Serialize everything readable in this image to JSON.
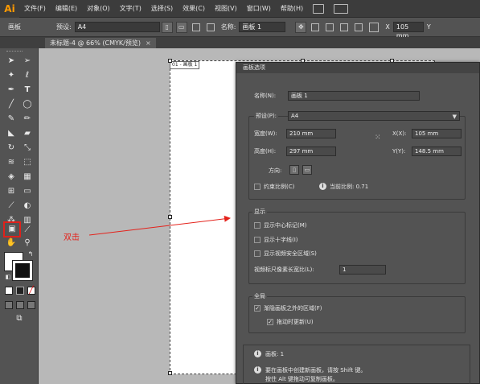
{
  "app": {
    "logo": "Ai"
  },
  "menu": [
    "文件(F)",
    "编辑(E)",
    "对象(O)",
    "文字(T)",
    "选择(S)",
    "效果(C)",
    "视图(V)",
    "窗口(W)",
    "帮助(H)"
  ],
  "controlbar": {
    "artboard_label": "画板",
    "preset_label": "预设:",
    "preset_value": "A4",
    "name_label": "名称:",
    "name_value": "画板 1",
    "x_label": "X",
    "x_value": "105 mm",
    "y_label": "Y"
  },
  "tab": {
    "title": "未标题-4 @ 66% (CMYK/预览)",
    "close": "×"
  },
  "artboard": {
    "label": "01 - 画板 1"
  },
  "annotation": {
    "text": "双击",
    "color": "#e4221b"
  },
  "dialog": {
    "title": "画板选项",
    "name_label": "名称(N):",
    "name_value": "画板 1",
    "preset_label": "预设(P):",
    "preset_value": "A4",
    "width_label": "宽度(W):",
    "width_value": "210 mm",
    "height_label": "高度(H):",
    "height_value": "297 mm",
    "x_label": "X(X):",
    "x_value": "105 mm",
    "y_label": "Y(Y):",
    "y_value": "148.5 mm",
    "orientation_label": "方向:",
    "constrain_label": "约束比例(C)",
    "current_ratio": "当前比例: 0.71",
    "display_group": "显示",
    "show_center": "显示中心标记(M)",
    "show_crosshair": "显示十字线(I)",
    "show_video_safe": "显示视频安全区域(S)",
    "video_ratio_label": "视频标尺像素长宽比(L):",
    "video_ratio_value": "1",
    "global_group": "全局",
    "fade_outside": "渐隐画板之外的区域(F)",
    "update_while_drag": "拖动时更新(U)",
    "artboards_count": "画板: 1",
    "info_line1": "要在画板中创建新画板，请按 Shift 键。",
    "info_line2": "按住 Alt 键拖动可复制画板。"
  }
}
